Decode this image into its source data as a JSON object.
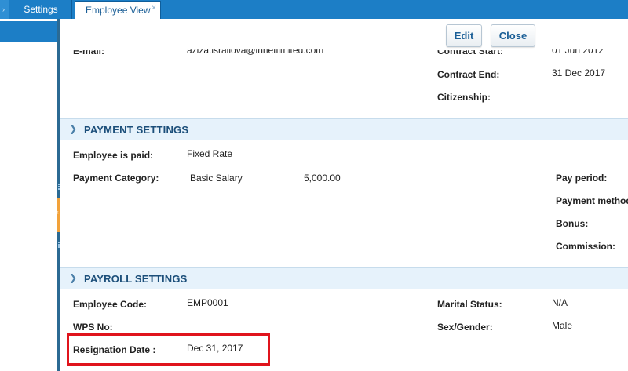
{
  "tabs": {
    "settings_label": "Settings",
    "active_label": "Employee View",
    "close_glyph": "×"
  },
  "toolbar": {
    "edit_label": "Edit",
    "close_label": "Close"
  },
  "top_section": {
    "email_label": "E-mail:",
    "email_value": "aziza.israilova@innetlimited.com",
    "contract_start_label": "Contract Start:",
    "contract_start_value": "01 Jun 2012",
    "contract_end_label": "Contract End:",
    "contract_end_value": "31 Dec 2017",
    "citizenship_label": "Citizenship:"
  },
  "payment_settings": {
    "title": "PAYMENT SETTINGS",
    "employee_is_paid_label": "Employee is paid:",
    "employee_is_paid_value": "Fixed Rate",
    "payment_category_label": "Payment Category:",
    "payment_category_value": "Basic Salary",
    "payment_amount": "5,000.00",
    "pay_period_label": "Pay period:",
    "payment_method_label": "Payment method",
    "bonus_label": "Bonus:",
    "commission_label": "Commission:"
  },
  "payroll_settings": {
    "title": "PAYROLL SETTINGS",
    "employee_code_label": "Employee Code:",
    "employee_code_value": "EMP0001",
    "wps_no_label": "WPS No:",
    "resignation_date_label": "Resignation Date :",
    "resignation_date_value": "Dec 31, 2017",
    "marital_status_label": "Marital Status:",
    "marital_status_value": "N/A",
    "sex_gender_label": "Sex/Gender:",
    "sex_gender_value": "Male"
  },
  "colors": {
    "tab_bar": "#1c7ec6",
    "section_header_bg": "#e6f2fb",
    "section_title": "#1c4f7a",
    "highlight": "#e0141c"
  }
}
